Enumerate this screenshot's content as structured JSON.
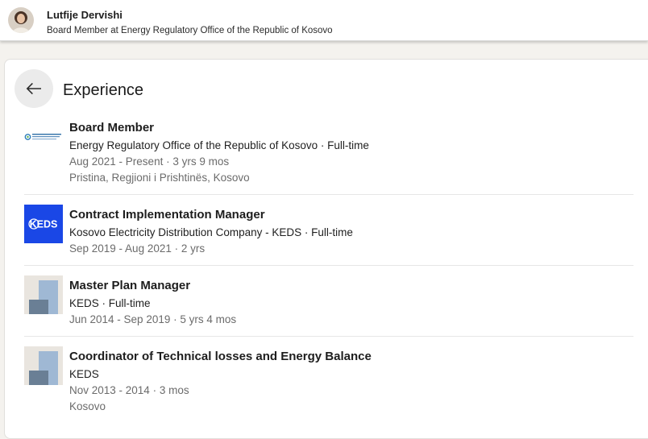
{
  "header": {
    "name": "Lutfije Dervishi",
    "headline": "Board Member at Energy Regulatory Office of the Republic of Kosovo"
  },
  "section": {
    "title": "Experience",
    "back_icon": "arrow-left-icon"
  },
  "experiences": [
    {
      "role": "Board Member",
      "company": "Energy Regulatory Office of the Republic of Kosovo · Full-time",
      "dates": "Aug 2021 - Present · 3 yrs 9 mos",
      "location": "Pristina, Regjioni i Prishtinës, Kosovo",
      "logo": "ero-logo"
    },
    {
      "role": "Contract Implementation Manager",
      "company": "Kosovo Electricity Distribution Company - KEDS · Full-time",
      "dates": "Sep 2019 - Aug 2021 · 2 yrs",
      "logo": "keds-logo",
      "logo_text": "KEDS"
    },
    {
      "role": "Master Plan Manager",
      "company": "KEDS · Full-time",
      "dates": "Jun 2014 - Sep 2019 · 5 yrs 4 mos",
      "logo": "placeholder-company-logo"
    },
    {
      "role": "Coordinator of Technical losses and Energy Balance",
      "company": "KEDS",
      "dates": "Nov 2013 - 2014 · 3 mos",
      "location": "Kosovo",
      "logo": "placeholder-company-logo"
    }
  ],
  "colors": {
    "keds_blue": "#1a47e6",
    "placeholder_bg": "#e9e5df",
    "placeholder_light": "#9fb8d4",
    "placeholder_dark": "#6a7f95"
  }
}
